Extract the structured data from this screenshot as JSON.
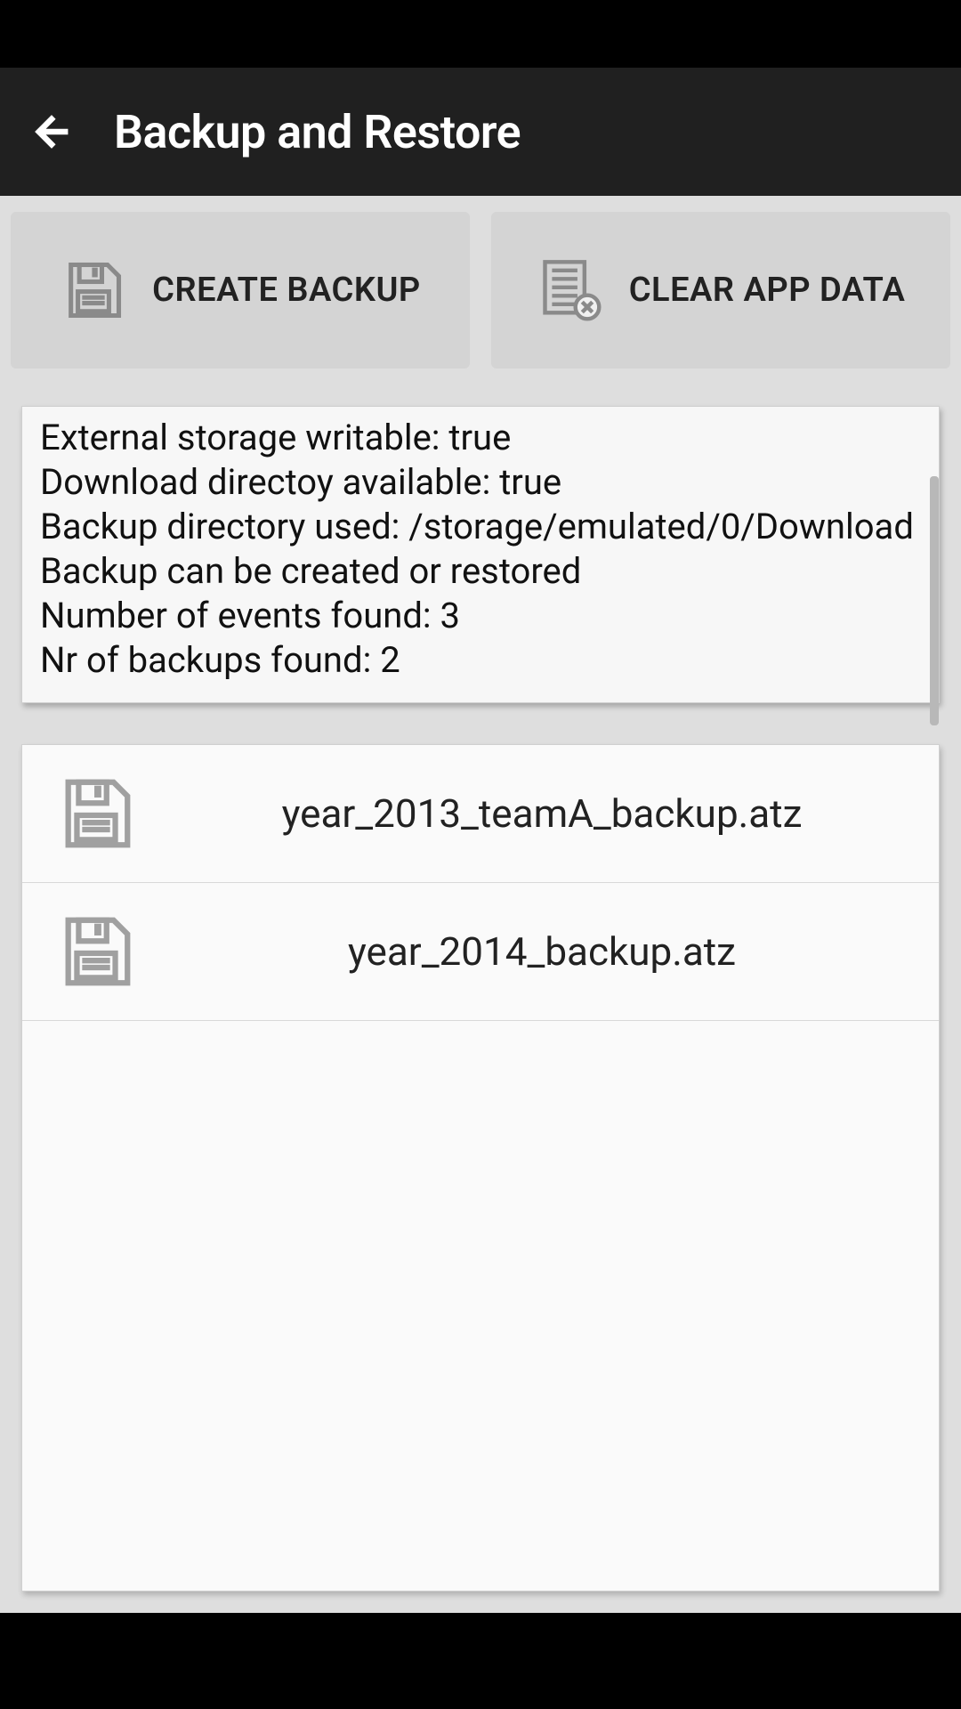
{
  "header": {
    "title": "Backup and Restore"
  },
  "actions": {
    "create_label": "CREATE BACKUP",
    "clear_label": "CLEAR APP DATA"
  },
  "info": {
    "lines": [
      "External storage writable: true",
      "Download directoy available: true",
      "Backup directory used: /storage/emulated/0/Download",
      "Backup can be created or restored",
      "Number of events found: 3",
      "Nr of backups found: 2"
    ]
  },
  "backups": [
    {
      "filename": "year_2013_teamA_backup.atz"
    },
    {
      "filename": "year_2014_backup.atz"
    }
  ]
}
